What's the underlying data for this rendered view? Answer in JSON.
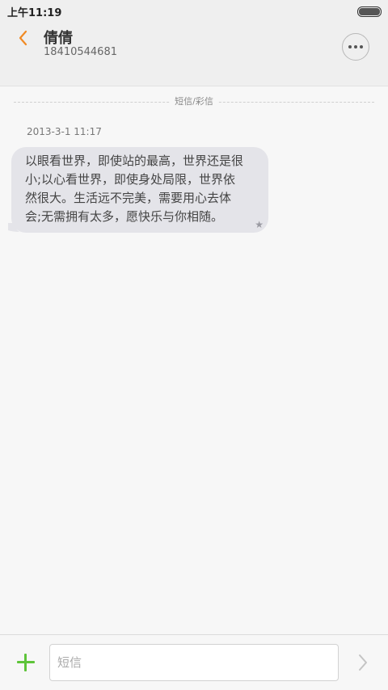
{
  "status_bar": {
    "time": "上午11:19"
  },
  "header": {
    "back_icon": "chevron-left-icon",
    "contact_name": "倩倩",
    "contact_number": "18410544681",
    "more_icon": "more-dots-icon"
  },
  "conversation": {
    "channel_label": "短信/彩信",
    "messages": [
      {
        "time": "2013-3-1 11:17",
        "text": "以眼看世界，即使站的最高，世界还是很小;以心看世界，即使身处局限，世界依然很大。生活远不完美，需要用心去体会;无需拥有太多，愿快乐与你相随。",
        "starred_icon": "star-icon"
      }
    ]
  },
  "compose": {
    "attach_icon": "plus-icon",
    "input_placeholder": "短信",
    "input_value": "",
    "send_icon": "chevron-right-icon"
  },
  "colors": {
    "accent_orange": "#f08a24",
    "attach_green": "#5ec43a",
    "bubble_bg": "#e4e4e9",
    "background": "#f7f7f7"
  }
}
